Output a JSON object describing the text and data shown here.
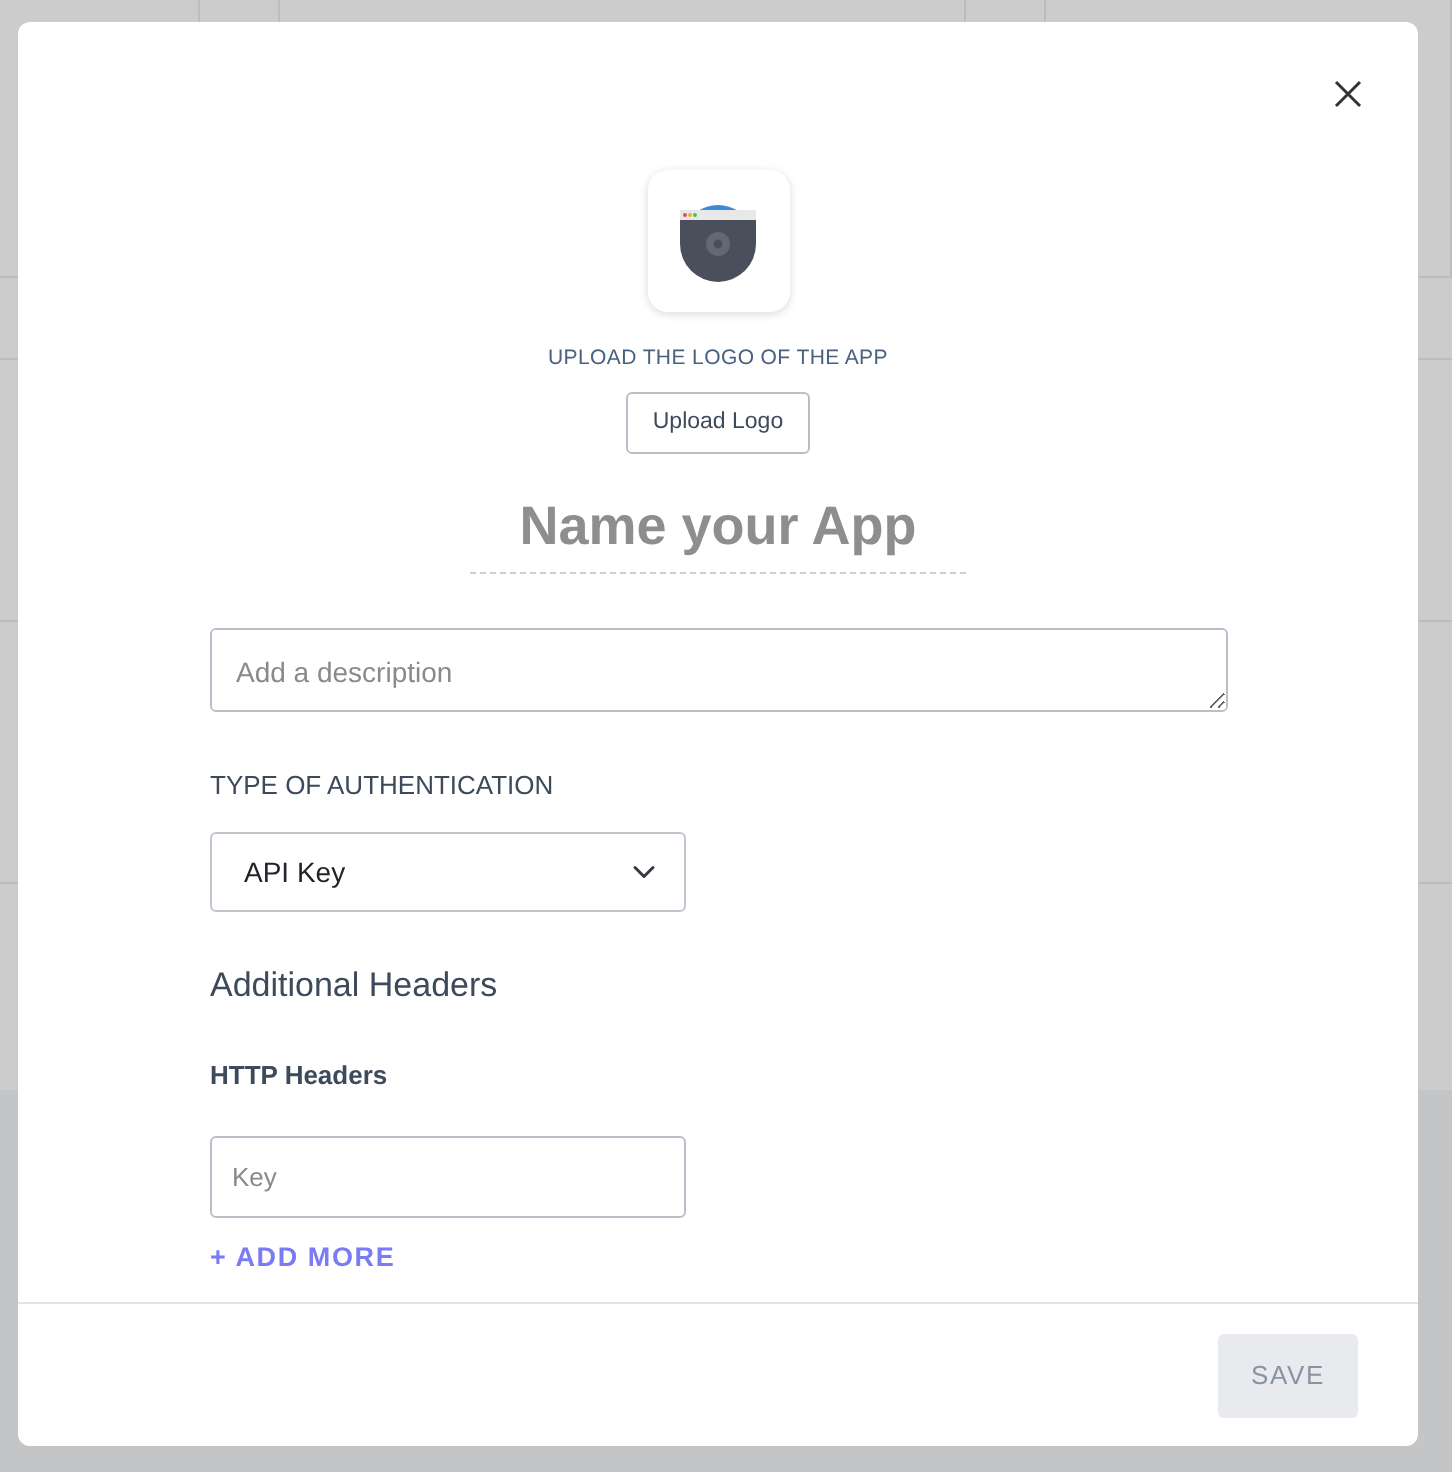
{
  "dialog": {
    "logo_label": "UPLOAD THE LOGO OF THE APP",
    "upload_button": "Upload Logo",
    "name_placeholder": "Name your App",
    "description": {
      "placeholder": "Add a description"
    },
    "auth_label": "TYPE OF AUTHENTICATION",
    "auth_select": {
      "value": "API Key"
    },
    "headers_title": "Additional Headers",
    "http_headers_label": "HTTP Headers",
    "key_field": {
      "placeholder": "Key"
    },
    "add_more": "+ ADD MORE",
    "save_button": {
      "label": "SAVE",
      "disabled": true
    }
  }
}
